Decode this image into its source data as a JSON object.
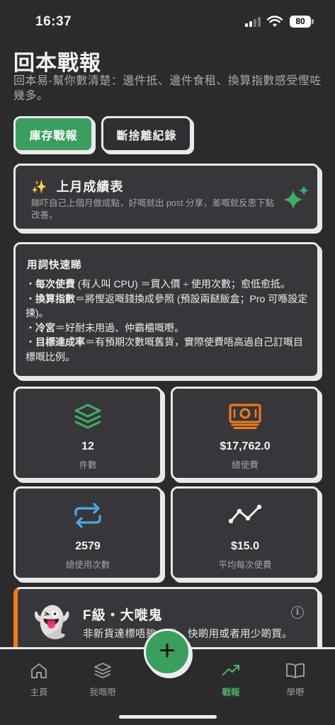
{
  "status_bar": {
    "time": "16:37",
    "battery": "80"
  },
  "header": {
    "title": "回本戰報",
    "subtitle": "回本易-幫你數清楚：邊件抵、邊件食租、換算指數感受慳咗幾多。"
  },
  "tabs": [
    {
      "label": "庫存戰報",
      "active": true
    },
    {
      "label": "斷捨離紀錄",
      "active": false
    }
  ],
  "report_card": {
    "emoji": "✨",
    "title": "上月成績表",
    "description": "睇吓自己上個月做成點，好嘅就出 post 分享，差嘅就反思下點改善。"
  },
  "glossary": {
    "title": "用詞快速睇",
    "items": [
      {
        "term": "每次使費",
        "definition": " (有人叫 CPU) ＝買入價 ÷ 使用次數；愈低愈抵。"
      },
      {
        "term": "換算指數",
        "definition": "＝將慳返嘅錢換成參照 (預設兩餸飯盒；Pro 可喺設定揀)。"
      },
      {
        "term": "冷宮",
        "definition": "＝好耐未用過、仲霸櫃嘅嘢。"
      },
      {
        "term": "目標達成率",
        "definition": "＝有預期次數嘅舊貨，實際使費唔高過自己訂嘅目標嘅比例。"
      }
    ]
  },
  "stats": [
    {
      "icon": "layers-icon",
      "value": "12",
      "label": "件數",
      "color": "#3fae67"
    },
    {
      "icon": "money-icon",
      "value": "$17,762.0",
      "label": "總使費",
      "color": "#f07c16"
    },
    {
      "icon": "repeat-icon",
      "value": "2579",
      "label": "總使用次數",
      "color": "#4aa8e8"
    },
    {
      "icon": "trend-icon",
      "value": "$15.0",
      "label": "平均每次使費",
      "color": "#f2f2f2"
    }
  ],
  "grade": {
    "emoji": "👻",
    "title": "F級・大嘥鬼",
    "description": "非新貨達標唔夠一半，快啲用或者用少啲買。",
    "accent": "#f07c16"
  },
  "nav": {
    "items": [
      {
        "label": "主頁",
        "icon": "home-icon"
      },
      {
        "label": "我嘅嘢",
        "icon": "layers-icon"
      },
      {
        "label": "戰報",
        "icon": "chart-icon",
        "active": true
      },
      {
        "label": "學嘢",
        "icon": "book-icon"
      }
    ],
    "fab": "+"
  },
  "colors": {
    "accent": "#3a9f5e",
    "background": "#2b2b2e",
    "card": "#37373b"
  }
}
